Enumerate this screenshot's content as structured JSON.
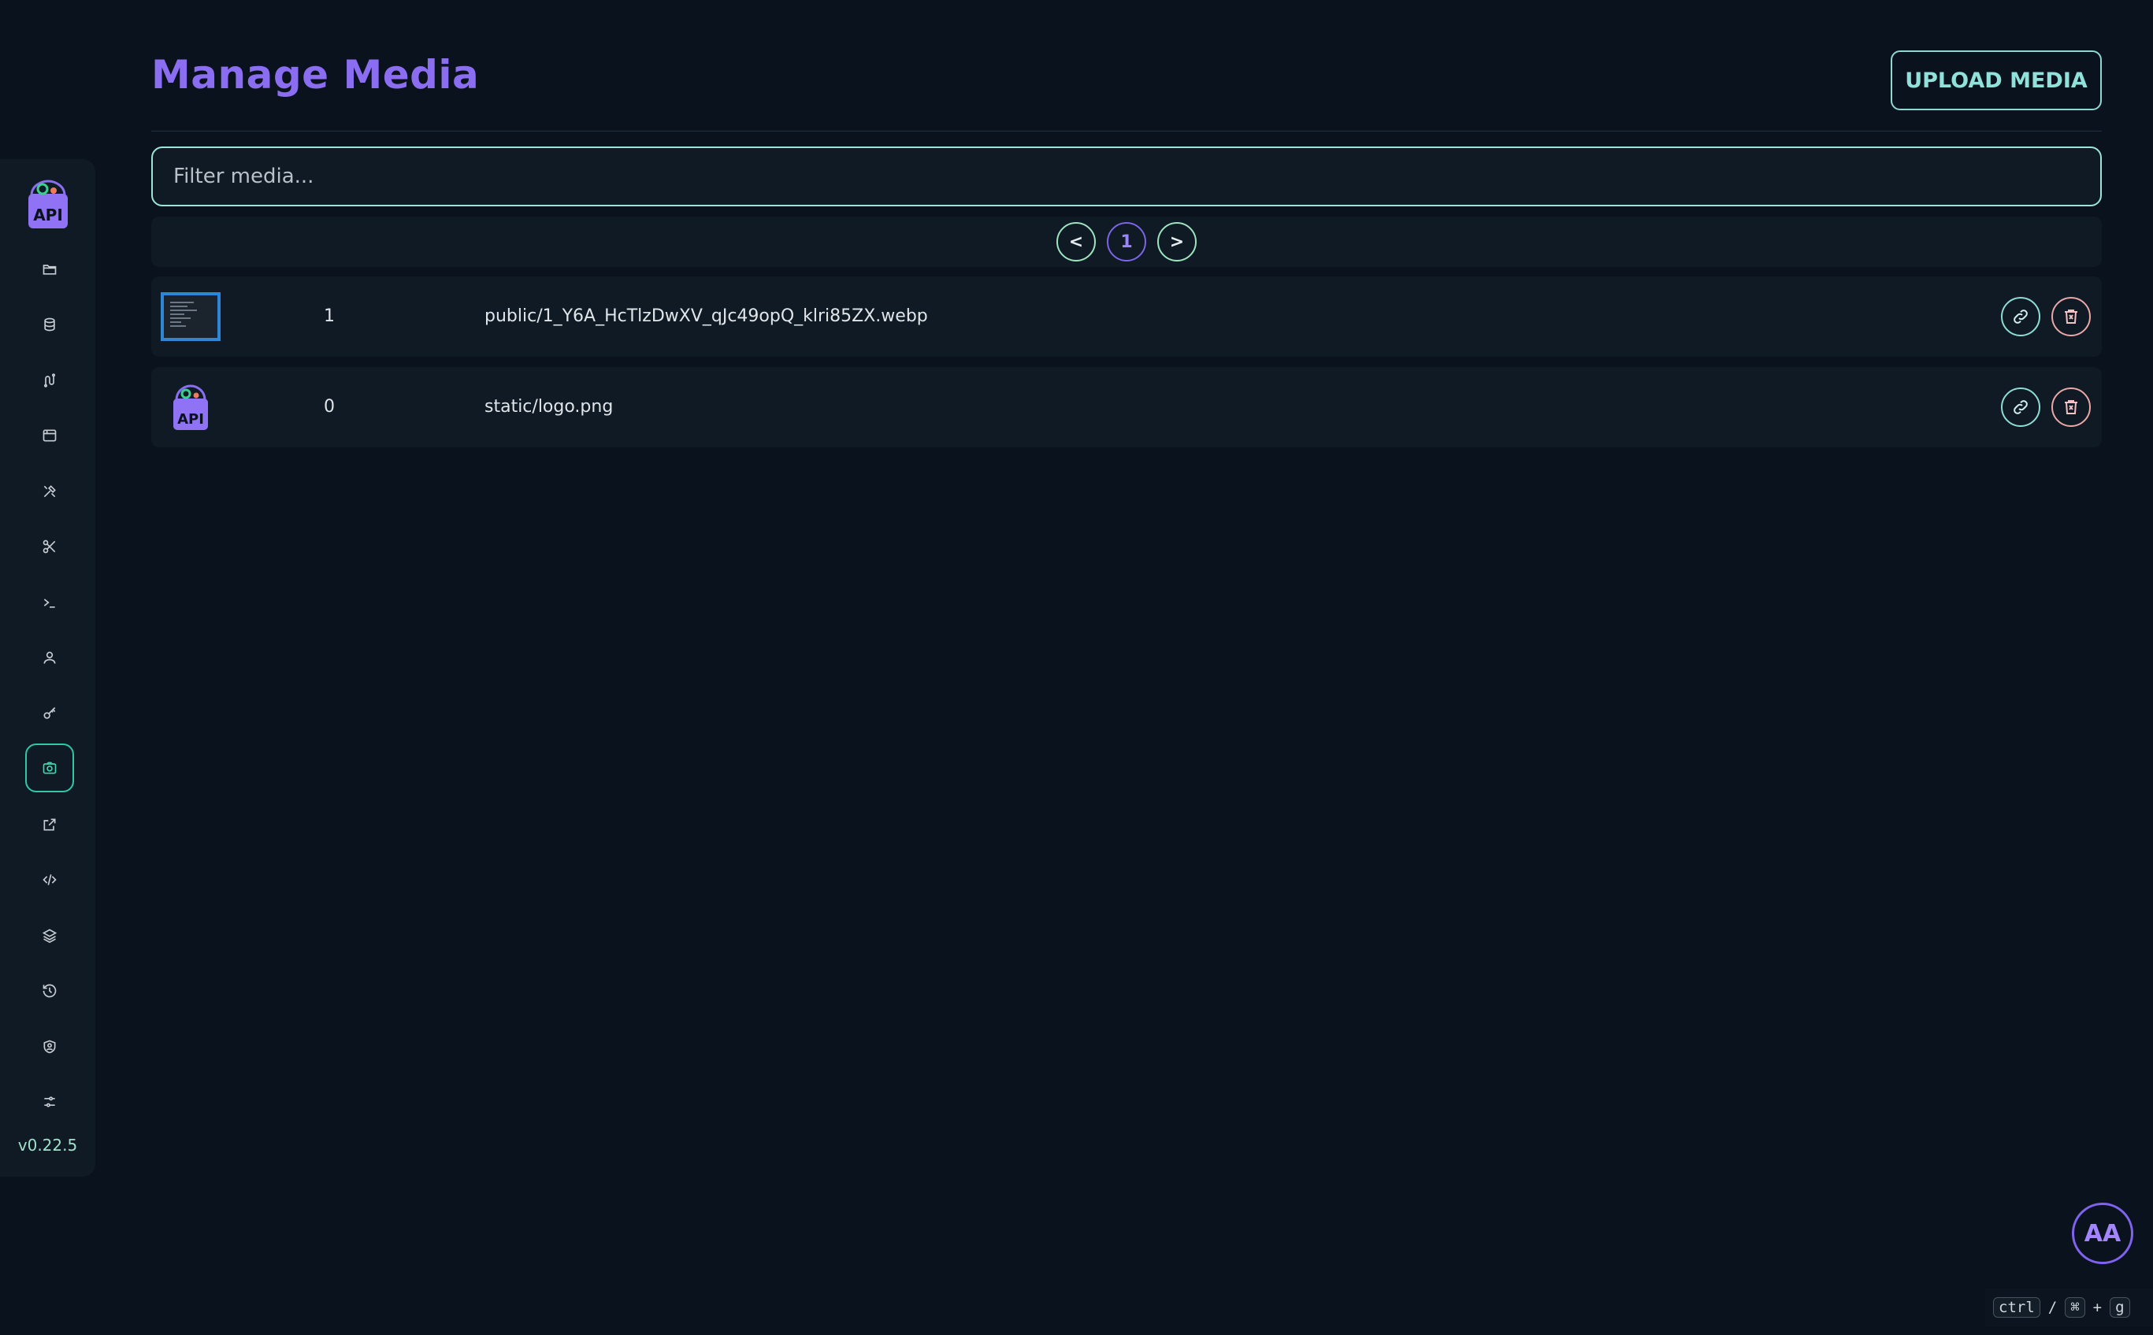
{
  "page": {
    "title": "Manage Media",
    "upload_label": "UPLOAD MEDIA"
  },
  "filter": {
    "placeholder": "Filter media...",
    "value": ""
  },
  "pagination": {
    "prev": "<",
    "current": "1",
    "next": ">"
  },
  "media": [
    {
      "count": "1",
      "path": "public/1_Y6A_HcTlzDwXV_qJc49opQ_klri85ZX.webp",
      "thumb": "screenshot-thumbnail"
    },
    {
      "count": "0",
      "path": "static/logo.png",
      "thumb": "api-logo"
    }
  ],
  "sidebar": {
    "logo_text": "API",
    "version": "v0.22.5",
    "items": [
      {
        "icon": "folder-icon",
        "active": false
      },
      {
        "icon": "database-icon",
        "active": false
      },
      {
        "icon": "route-icon",
        "active": false
      },
      {
        "icon": "window-icon",
        "active": false
      },
      {
        "icon": "tools-icon",
        "active": false
      },
      {
        "icon": "scissors-icon",
        "active": false
      },
      {
        "icon": "terminal-icon",
        "active": false
      },
      {
        "icon": "user-icon",
        "active": false
      },
      {
        "icon": "key-icon",
        "active": false
      },
      {
        "icon": "camera-icon",
        "active": true
      },
      {
        "icon": "external-link-icon",
        "active": false
      },
      {
        "icon": "code-icon",
        "active": false
      },
      {
        "icon": "layers-icon",
        "active": false
      },
      {
        "icon": "history-icon",
        "active": false
      },
      {
        "icon": "user-shield-icon",
        "active": false
      },
      {
        "icon": "settings-dots-icon",
        "active": false
      }
    ]
  },
  "accessibility": {
    "label": "AA"
  },
  "shortcut": {
    "key1": "ctrl",
    "sep": "/",
    "key2": "⌘",
    "plus": "+",
    "key3": "g"
  },
  "colors": {
    "background": "#0a131d",
    "panel": "#0f1a24",
    "title": "#8b6df2",
    "accent": "#2fc8a4",
    "danger": "#e9a7a7"
  }
}
